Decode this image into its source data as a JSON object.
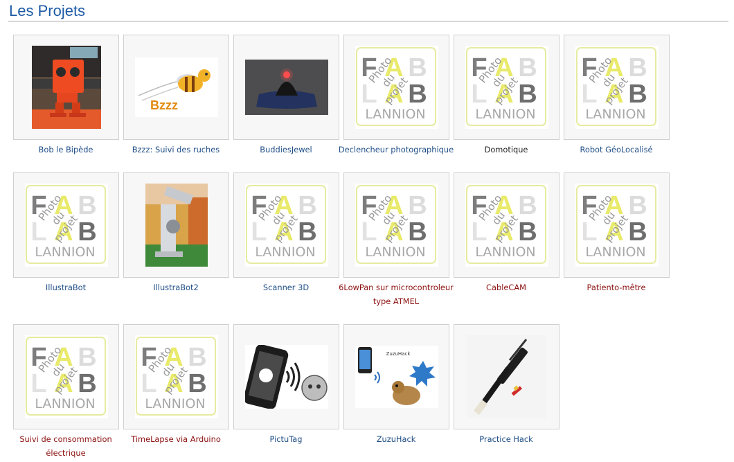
{
  "page": {
    "title": "Les Projets"
  },
  "colors": {
    "title": "#1d5aa5",
    "link": "#1f4e86",
    "link_red": "#8c1010",
    "text": "#222222",
    "border": "#cfcfcf"
  },
  "placeholder": {
    "letters": [
      "F",
      "A",
      "B",
      "L",
      "A",
      "B"
    ],
    "stamp_lines": [
      "Photo",
      "du",
      "projet"
    ],
    "city": "LANNION"
  },
  "projects": [
    {
      "title": "Bob le Bipède",
      "image": "robot-photo",
      "link_color": "blue"
    },
    {
      "title": "Bzzz: Suivi des ruches",
      "image": "bee-logo",
      "link_color": "blue",
      "logo_text": "Bzzz"
    },
    {
      "title": "BuddiesJewel",
      "image": "jewel-photo",
      "link_color": "blue"
    },
    {
      "title": "Declencheur photographique",
      "image": "placeholder",
      "link_color": "blue"
    },
    {
      "title": "Domotique",
      "image": "placeholder",
      "link_color": "black"
    },
    {
      "title": "Robot GéoLocalisé",
      "image": "placeholder",
      "link_color": "blue"
    },
    {
      "title": "IllustraBot",
      "image": "placeholder",
      "link_color": "blue"
    },
    {
      "title": "IllustraBot2",
      "image": "robot-arm-photo",
      "link_color": "blue"
    },
    {
      "title": "Scanner 3D",
      "image": "placeholder",
      "link_color": "blue"
    },
    {
      "title": "6LowPan sur microcontroleur type ATMEL",
      "image": "placeholder",
      "link_color": "red"
    },
    {
      "title": "CableCAM",
      "image": "placeholder",
      "link_color": "red"
    },
    {
      "title": "Patiento-mêtre",
      "image": "placeholder",
      "link_color": "red"
    },
    {
      "title": "Suivi de consommation électrique",
      "image": "placeholder",
      "link_color": "red"
    },
    {
      "title": "TimeLapse via Arduino",
      "image": "placeholder",
      "link_color": "red"
    },
    {
      "title": "PictuTag",
      "image": "pictutag-illustration",
      "link_color": "blue"
    },
    {
      "title": "ZuzuHack",
      "image": "zuzuhack-illustration",
      "link_color": "blue",
      "logo_text": "ZuzuHack"
    },
    {
      "title": "Practice Hack",
      "image": "bagpipe-chanter-photo",
      "link_color": "blue"
    }
  ]
}
